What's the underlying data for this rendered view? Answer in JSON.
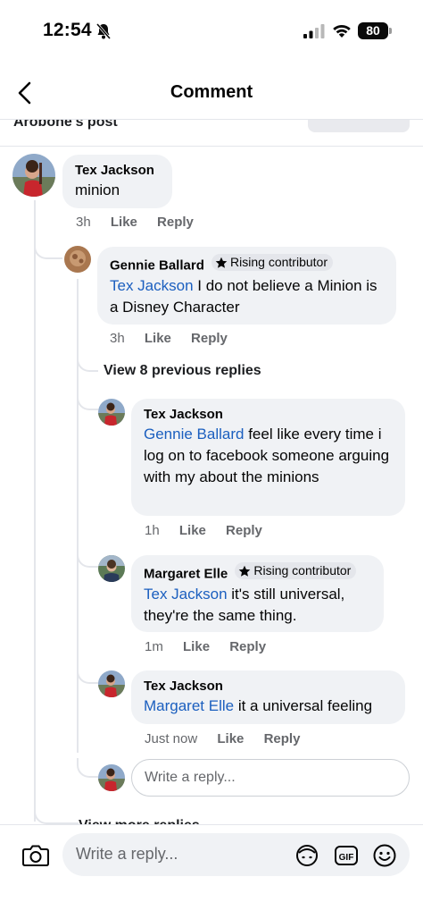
{
  "status_bar": {
    "time": "12:54",
    "battery": "80"
  },
  "header": {
    "title": "Comment"
  },
  "post_ref": {
    "label": "Arobone's post"
  },
  "comments": [
    {
      "author": "Tex Jackson",
      "mention": "",
      "text": "minion",
      "time": "3h",
      "like": "Like",
      "reply": "Reply"
    },
    {
      "author": "Gennie Ballard",
      "badge": "Rising contributor",
      "mention": "Tex Jackson",
      "text": " I do not believe a Minion is a Disney Character",
      "time": "3h",
      "like": "Like",
      "reply": "Reply"
    },
    {
      "author": "Tex Jackson",
      "mention": "Gennie Ballard",
      "text": " feel like every time i log on to facebook someone arguing with my about the minions",
      "time": "1h",
      "like": "Like",
      "reply": "Reply"
    },
    {
      "author": "Margaret Elle",
      "badge": "Rising contributor",
      "mention": "Tex Jackson",
      "text": " it's still universal, they're the same thing.",
      "time": "1m",
      "like": "Like",
      "reply": "Reply"
    },
    {
      "author": "Tex Jackson",
      "mention": "Margaret Elle",
      "text": " it a universal feeling",
      "time": "Just now",
      "like": "Like",
      "reply": "Reply"
    }
  ],
  "view_previous": "View 8 previous replies",
  "view_more": "View more replies",
  "reply_input": {
    "placeholder": "Write a reply..."
  },
  "composer": {
    "placeholder": "Write a reply..."
  },
  "icons": [
    "back-arrow-icon",
    "bell-off-icon",
    "signal-icon",
    "wifi-icon",
    "battery-icon",
    "camera-icon",
    "avatar-sticker-icon",
    "gif-icon",
    "emoji-icon",
    "star-icon"
  ]
}
